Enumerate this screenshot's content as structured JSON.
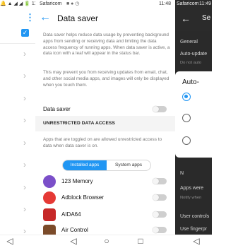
{
  "left": {
    "status": "🔔 ▲ ◢ ◢ 🔋 11:48",
    "menu_glyph": "⋮",
    "check_glyph": "✓"
  },
  "center": {
    "status_left": "Safaricom",
    "status_right": "11:48",
    "title": "Data saver",
    "description": "Data saver helps reduce data usage by preventing background apps from sending or receiving data and limiting the data access frequency of running apps. When data saver is active, a data icon with a leaf will appear in the status bar.",
    "description2": "This may prevent you from receiving updates from email, chat, and other social media apps, and images will only be displayed when you touch them.",
    "data_saver_label": "Data saver",
    "section_title": "UNRESTRICTED DATA ACCESS",
    "section_desc": "Apps that are toggled on are allowed unrestricted access to data when data saver is on.",
    "tabs": [
      {
        "label": "Installed apps",
        "active": true
      },
      {
        "label": "System apps",
        "active": false
      }
    ],
    "apps": [
      {
        "name": "123 Memory"
      },
      {
        "name": "Adblock Browser"
      },
      {
        "name": "AIDA64"
      },
      {
        "name": "Air Control"
      }
    ]
  },
  "right": {
    "status_left": "Safaricom",
    "status_right": "11:49",
    "title": "Se",
    "general": "General",
    "auto_update_title": "Auto-update",
    "auto_update_sub": "Do not auto",
    "dialog_title": "Auto-",
    "label_n": "N",
    "apps_were": "Apps were",
    "notify_when": "Notify when",
    "user_controls": "User controls",
    "use_fingerprint": "Use fingerpr"
  },
  "nav": {
    "back": "◁",
    "home": "○",
    "recent": "□"
  },
  "colors": {
    "accent": "#2196f3",
    "switch_off": "#cfcfcf",
    "dark_panel": "#2b2b2b",
    "section_band": "#f4f4f4"
  }
}
